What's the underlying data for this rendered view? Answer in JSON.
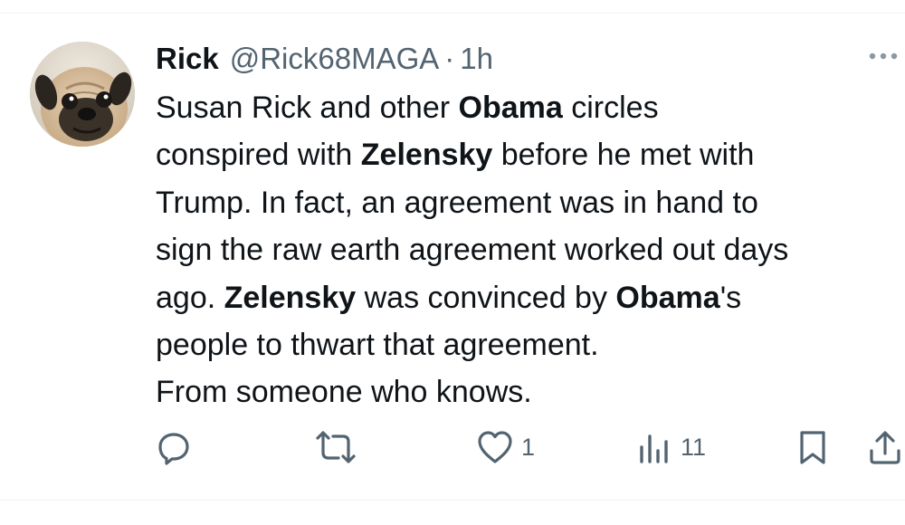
{
  "post": {
    "author_name": "Rick",
    "author_handle": "@Rick68MAGA",
    "separator": "·",
    "timestamp": "1h",
    "text_lines": [
      [
        "Susan Rick and other ",
        "Obama",
        " circles"
      ],
      [
        "conspired with ",
        "Zelensky",
        " before he met with"
      ],
      [
        "Trump. In fact, an agreement was in hand to"
      ],
      [
        "sign the raw earth agreement worked out days"
      ],
      [
        "ago. ",
        "Zelensky",
        " was convinced by ",
        "Obama",
        "'s"
      ],
      [
        "people to thwart that agreement."
      ],
      [
        "From someone who knows."
      ]
    ],
    "line1": {
      "a": "Susan Rick and other ",
      "b": "Obama",
      "c": " circles"
    },
    "line2": {
      "a": "conspired with ",
      "b": "Zelensky",
      "c": " before he met with"
    },
    "line3": "Trump. In fact, an agreement was in hand to",
    "line4": "sign the raw earth agreement worked out days",
    "line5": {
      "a": "ago. ",
      "b": "Zelensky",
      "c": " was convinced by ",
      "d": "Obama",
      "e": "'s"
    },
    "line6": "people to thwart that agreement.",
    "line7": "From someone who knows."
  },
  "actions": {
    "reply": {
      "icon": "reply-icon",
      "count": ""
    },
    "repost": {
      "icon": "repost-icon",
      "count": ""
    },
    "like": {
      "icon": "heart-icon",
      "count": "1"
    },
    "views": {
      "icon": "views-icon",
      "count": "11"
    },
    "bookmark": {
      "icon": "bookmark-icon"
    },
    "share": {
      "icon": "share-icon"
    }
  },
  "colors": {
    "text": "#0f1419",
    "secondary": "#536471",
    "divider": "#eff3f4",
    "more_dots": "#8b98a5"
  }
}
